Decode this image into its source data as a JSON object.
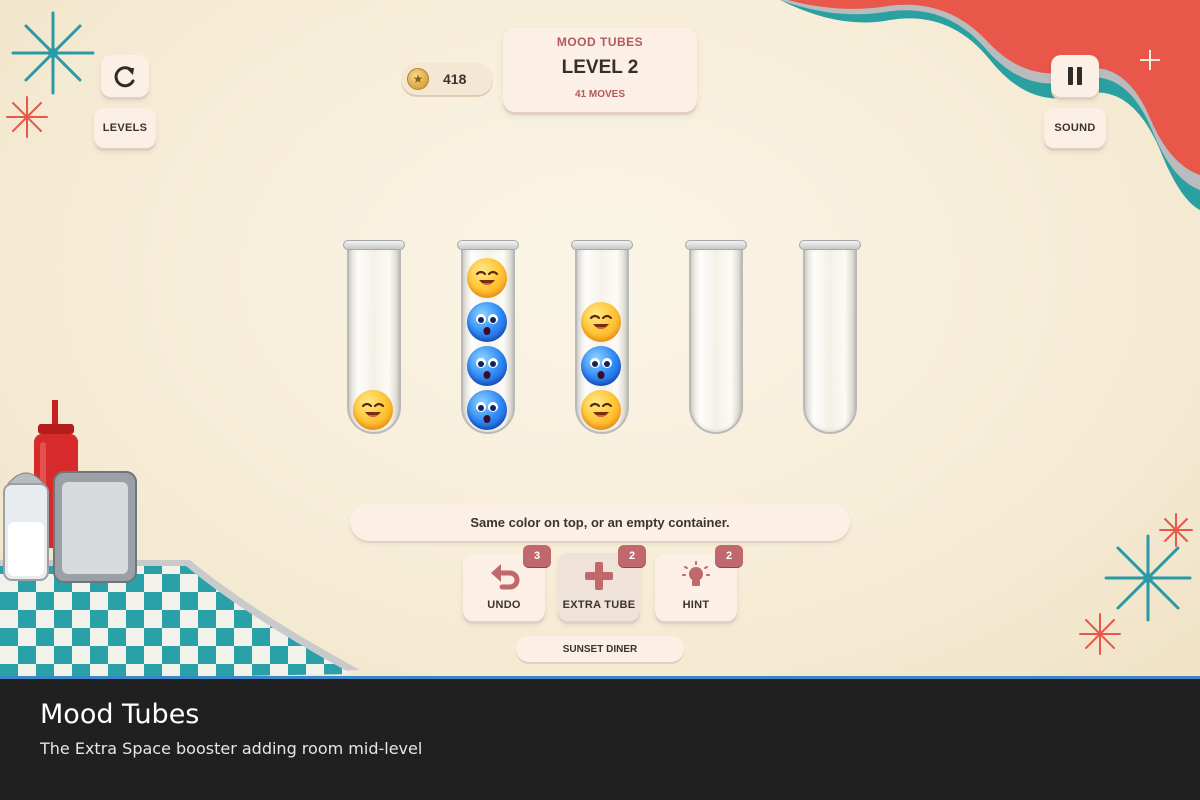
{
  "header": {
    "game_title": "MOOD TUBES",
    "level": "LEVEL 2",
    "moves": "41 MOVES",
    "coins": "418"
  },
  "controls": {
    "levels_label": "LEVELS",
    "sound_label": "SOUND"
  },
  "tubes": [
    {
      "balls": [
        "yellow"
      ]
    },
    {
      "balls": [
        "blue",
        "blue",
        "blue",
        "yellow"
      ]
    },
    {
      "balls": [
        "yellow",
        "blue",
        "yellow"
      ]
    },
    {
      "balls": []
    },
    {
      "balls": []
    }
  ],
  "hint_text": "Same color on top, or an empty container.",
  "boosters": {
    "undo": {
      "label": "UNDO",
      "count": "3"
    },
    "extra_tube": {
      "label": "EXTRA TUBE",
      "count": "2"
    },
    "hint": {
      "label": "HINT",
      "count": "2"
    }
  },
  "theme": "SUNSET DINER",
  "caption": {
    "title": "Mood Tubes",
    "subtitle": "The Extra Space booster adding room mid-level"
  },
  "colors": {
    "accent_red": "#c0686b",
    "ball_yellow": "#ffc83a",
    "ball_blue": "#2f8af5",
    "background": "#f6ecd6"
  }
}
